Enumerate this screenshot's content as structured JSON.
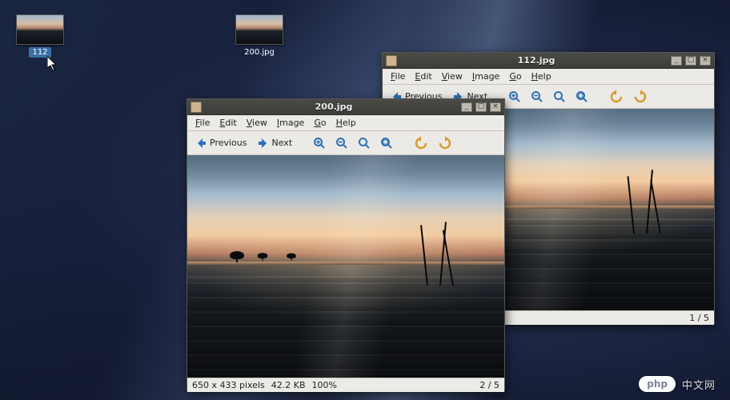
{
  "desktop": {
    "icons": [
      {
        "name": "112",
        "selected": true
      },
      {
        "name": "200.jpg",
        "selected": false
      }
    ]
  },
  "menus": [
    "File",
    "Edit",
    "View",
    "Image",
    "Go",
    "Help"
  ],
  "toolbar": {
    "prev_label": "Previous",
    "next_label": "Next"
  },
  "windows": {
    "front": {
      "title": "200.jpg",
      "status": {
        "dimensions": "650 x 433 pixels",
        "size": "42.2 KB",
        "zoom": "100%",
        "index": "2 / 5"
      }
    },
    "back": {
      "title": "112.jpg",
      "status": {
        "index": "1 / 5"
      }
    }
  },
  "watermark": {
    "brand_left": "php",
    "brand_right": "中文网"
  }
}
